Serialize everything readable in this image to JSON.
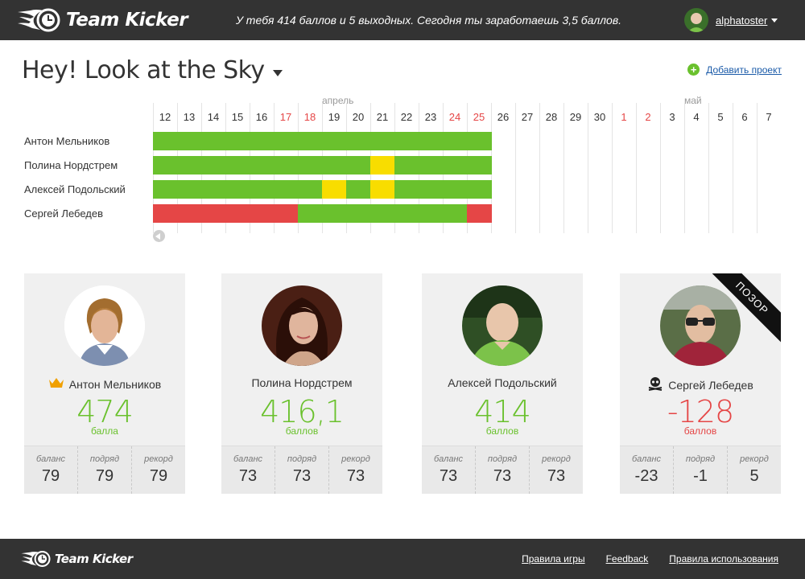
{
  "app": {
    "name": "Team Kicker"
  },
  "header": {
    "message": "У тебя 414 баллов и 5 выходных. Сегодня ты заработаешь 3,5 баллов.",
    "username": "alphatoster"
  },
  "project": {
    "title": "Hey! Look at the Sky",
    "add_label": "Добавить проект"
  },
  "timeline": {
    "months": [
      {
        "name": "апрель",
        "col": 7
      },
      {
        "name": "май",
        "col": 22
      }
    ],
    "days": [
      {
        "n": "12",
        "weekend": false
      },
      {
        "n": "13",
        "weekend": false
      },
      {
        "n": "14",
        "weekend": false
      },
      {
        "n": "15",
        "weekend": false
      },
      {
        "n": "16",
        "weekend": false
      },
      {
        "n": "17",
        "weekend": true
      },
      {
        "n": "18",
        "weekend": true
      },
      {
        "n": "19",
        "weekend": false
      },
      {
        "n": "20",
        "weekend": false
      },
      {
        "n": "21",
        "weekend": false
      },
      {
        "n": "22",
        "weekend": false
      },
      {
        "n": "23",
        "weekend": false
      },
      {
        "n": "24",
        "weekend": true
      },
      {
        "n": "25",
        "weekend": true
      },
      {
        "n": "26",
        "weekend": false
      },
      {
        "n": "27",
        "weekend": false
      },
      {
        "n": "28",
        "weekend": false
      },
      {
        "n": "29",
        "weekend": false
      },
      {
        "n": "30",
        "weekend": false
      },
      {
        "n": "1",
        "weekend": true
      },
      {
        "n": "2",
        "weekend": true
      },
      {
        "n": "3",
        "weekend": false
      },
      {
        "n": "4",
        "weekend": false
      },
      {
        "n": "5",
        "weekend": false
      },
      {
        "n": "6",
        "weekend": false
      },
      {
        "n": "7",
        "weekend": false
      }
    ],
    "rows": [
      {
        "name": "Антон Мельников",
        "days": [
          "g",
          "g",
          "g",
          "g",
          "g",
          "g",
          "g",
          "g",
          "g",
          "g",
          "g",
          "g",
          "g",
          "g"
        ]
      },
      {
        "name": "Полина Нордстрем",
        "days": [
          "g",
          "g",
          "g",
          "g",
          "g",
          "g",
          "g",
          "g",
          "g",
          "y",
          "g",
          "g",
          "g",
          "g"
        ]
      },
      {
        "name": "Алексей Подольский",
        "days": [
          "g",
          "g",
          "g",
          "g",
          "g",
          "g",
          "g",
          "y",
          "g",
          "y",
          "g",
          "g",
          "g",
          "g"
        ]
      },
      {
        "name": "Сергей Лебедев",
        "days": [
          "r",
          "r",
          "r",
          "r",
          "r",
          "r",
          "g",
          "g",
          "g",
          "g",
          "g",
          "g",
          "g",
          "r"
        ]
      }
    ]
  },
  "colors": {
    "green": "#6ac12d",
    "yellow": "#f8dd00",
    "red": "#e54646"
  },
  "cards": [
    {
      "name": "Антон Мельников",
      "badge": "crown-icon",
      "score": "474",
      "unit": "балла",
      "negative": false,
      "stats": [
        {
          "label": "баланс",
          "value": "79"
        },
        {
          "label": "подряд",
          "value": "79"
        },
        {
          "label": "рекорд",
          "value": "79"
        }
      ],
      "ribbon": ""
    },
    {
      "name": "Полина Нордстрем",
      "badge": "",
      "score": "416,1",
      "unit": "баллов",
      "negative": false,
      "stats": [
        {
          "label": "баланс",
          "value": "73"
        },
        {
          "label": "подряд",
          "value": "73"
        },
        {
          "label": "рекорд",
          "value": "73"
        }
      ],
      "ribbon": ""
    },
    {
      "name": "Алексей Подольский",
      "badge": "",
      "score": "414",
      "unit": "баллов",
      "negative": false,
      "stats": [
        {
          "label": "баланс",
          "value": "73"
        },
        {
          "label": "подряд",
          "value": "73"
        },
        {
          "label": "рекорд",
          "value": "73"
        }
      ],
      "ribbon": ""
    },
    {
      "name": "Сергей Лебедев",
      "badge": "skull-icon",
      "score": "-128",
      "unit": "баллов",
      "negative": true,
      "stats": [
        {
          "label": "баланс",
          "value": "-23"
        },
        {
          "label": "подряд",
          "value": "-1"
        },
        {
          "label": "рекорд",
          "value": "5"
        }
      ],
      "ribbon": "ПОЗОР"
    }
  ],
  "footer": {
    "links": [
      "Правила игры",
      "Feedback",
      "Правила использования"
    ]
  }
}
